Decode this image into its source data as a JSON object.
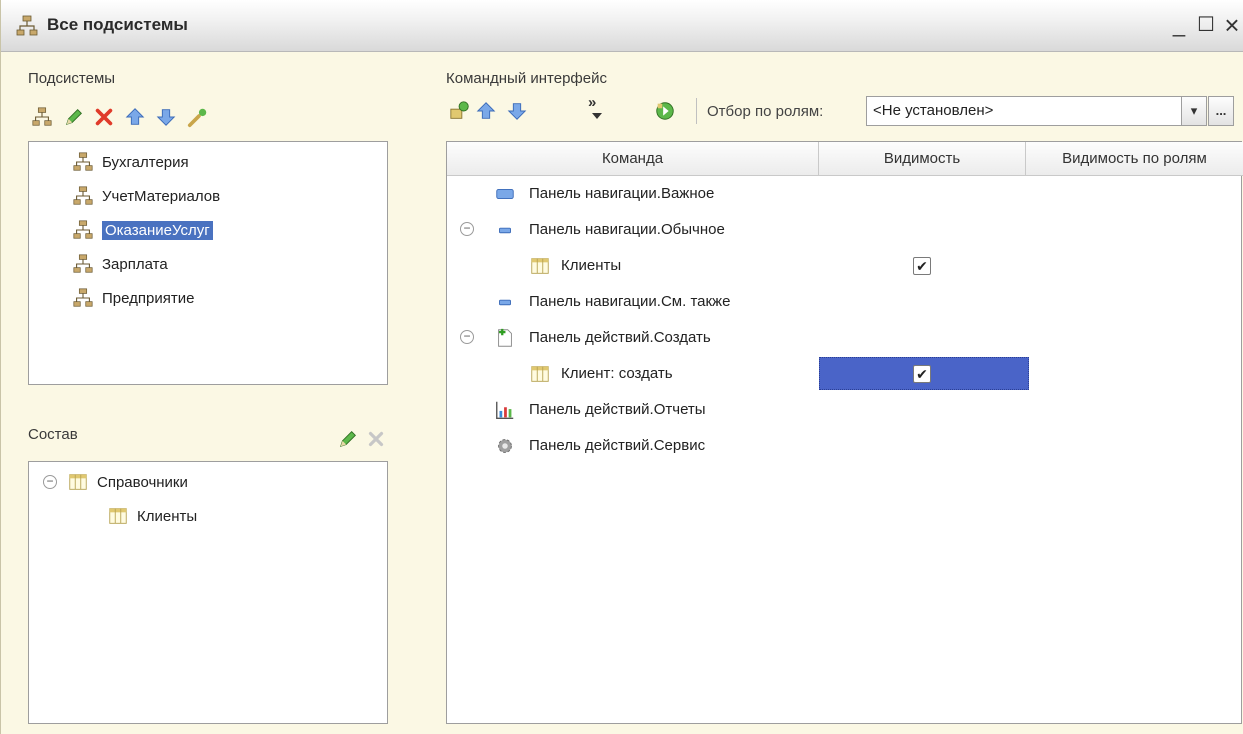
{
  "window": {
    "title": "Все подсистемы",
    "minimize_label": "_",
    "maximize_label": "☐",
    "close_label": "×"
  },
  "subsystems": {
    "label": "Подсистемы",
    "items": [
      {
        "label": "Бухгалтерия"
      },
      {
        "label": "УчетМатериалов"
      },
      {
        "label": "ОказаниеУслуг",
        "selected": true
      },
      {
        "label": "Зарплата"
      },
      {
        "label": "Предприятие"
      }
    ]
  },
  "composition": {
    "label": "Состав",
    "items": [
      {
        "label": "Справочники"
      },
      {
        "label": "Клиенты"
      }
    ]
  },
  "command_interface": {
    "label": "Командный интерфейс",
    "more_glyph": "»",
    "role_filter_label": "Отбор по ролям:",
    "role_filter_value": "<Не установлен>",
    "dropdown_glyph": "▾",
    "ellipsis_label": "...",
    "columns": [
      "Команда",
      "Видимость",
      "Видимость по ролям"
    ],
    "rows": [
      {
        "label": "Панель навигации.Важное",
        "visible": null
      },
      {
        "label": "Панель навигации.Обычное",
        "visible": null,
        "expanded": true
      },
      {
        "label": "Клиенты",
        "visible": true
      },
      {
        "label": "Панель навигации.См. также",
        "visible": null
      },
      {
        "label": "Панель действий.Создать",
        "visible": null,
        "expanded": true
      },
      {
        "label": "Клиент: создать",
        "visible": true,
        "selected": true
      },
      {
        "label": "Панель действий.Отчеты",
        "visible": null
      },
      {
        "label": "Панель действий.Сервис",
        "visible": null
      }
    ],
    "check_glyph": "✔",
    "collapse_glyph": "−"
  },
  "colors": {
    "selection": "#4a72c0",
    "window_bg": "#fbf8e4"
  }
}
